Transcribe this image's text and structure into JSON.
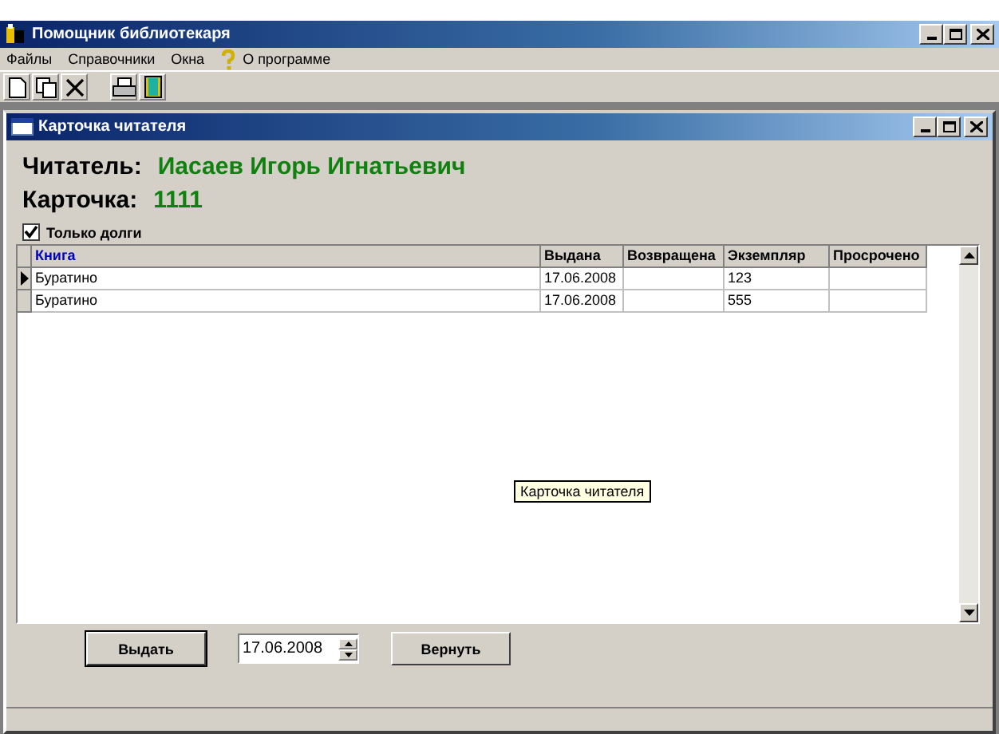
{
  "window": {
    "title": "Помощник библиотекаря"
  },
  "menu": [
    {
      "label": "Файлы",
      "kind": "text"
    },
    {
      "label": "Справочники",
      "kind": "text"
    },
    {
      "label": "Окна",
      "kind": "text"
    },
    {
      "label": "О программе",
      "kind": "help"
    }
  ],
  "child_window": {
    "title": "Карточка читателя"
  },
  "reader": {
    "label": "Читатель:",
    "value": "Иасаев Игорь Игнатьевич"
  },
  "card": {
    "label": "Карточка:",
    "value": "1111"
  },
  "only_debts": {
    "label": "Только долги",
    "checked": true
  },
  "table": {
    "columns": [
      "Книга",
      "Выдана",
      "Возвращена",
      "Экземпляр",
      "Просрочено"
    ],
    "rows": [
      {
        "selected": true,
        "cells": [
          "Буратино",
          "17.06.2008",
          "",
          "123",
          ""
        ]
      },
      {
        "selected": false,
        "cells": [
          "Буратино",
          "17.06.2008",
          "",
          "555",
          ""
        ]
      }
    ]
  },
  "issue_button": "Выдать",
  "date_field": {
    "value": "17.06.2008"
  },
  "return_button": "Вернуть",
  "tooltip": "Карточка читателя"
}
